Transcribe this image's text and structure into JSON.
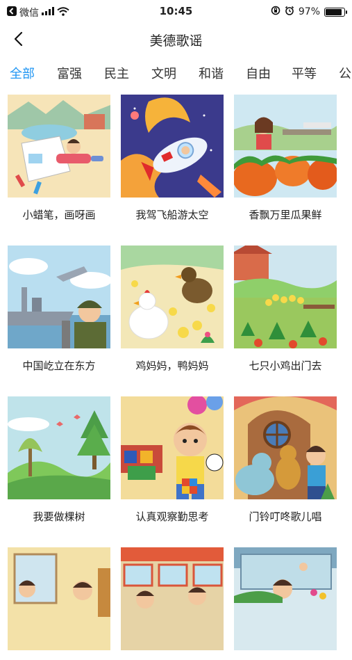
{
  "status_bar": {
    "carrier": "微信",
    "time": "10:45",
    "battery_percent": "97%",
    "battery_level": 0.97
  },
  "header": {
    "title": "美德歌谣"
  },
  "tabs": [
    "全部",
    "富强",
    "民主",
    "文明",
    "和谐",
    "自由",
    "平等",
    "公"
  ],
  "active_tab_index": 0,
  "songs": [
    {
      "title": "小蜡笔，画呀画"
    },
    {
      "title": "我驾飞船游太空"
    },
    {
      "title": "香飘万里瓜果鲜"
    },
    {
      "title": "中国屹立在东方"
    },
    {
      "title": "鸡妈妈，鸭妈妈"
    },
    {
      "title": "七只小鸡出门去"
    },
    {
      "title": "我要做棵树"
    },
    {
      "title": "认真观察勤思考"
    },
    {
      "title": "门铃叮咚歌儿唱"
    },
    {
      "title": ""
    },
    {
      "title": ""
    },
    {
      "title": ""
    }
  ],
  "colors": {
    "accent": "#2196f3"
  }
}
